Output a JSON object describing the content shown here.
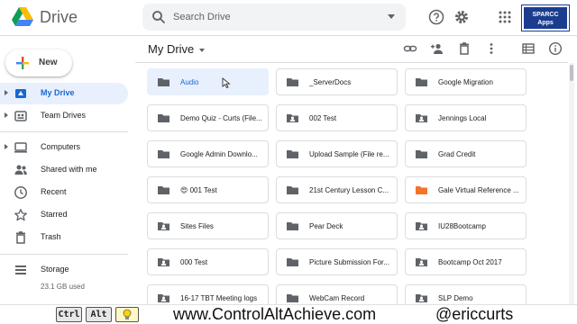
{
  "app": {
    "title": "Drive"
  },
  "search": {
    "placeholder": "Search Drive"
  },
  "org_badge": {
    "line1": "SPARCC",
    "line2": "Apps"
  },
  "sidebar": {
    "new_label": "New",
    "items": [
      {
        "label": "My Drive",
        "icon": "my-drive-icon",
        "active": true,
        "expandable": true
      },
      {
        "label": "Team Drives",
        "icon": "team-drives-icon",
        "active": false,
        "expandable": true
      },
      {
        "label": "Computers",
        "icon": "computers-icon",
        "active": false,
        "expandable": true
      },
      {
        "label": "Shared with me",
        "icon": "shared-icon",
        "active": false,
        "expandable": false
      },
      {
        "label": "Recent",
        "icon": "clock-icon",
        "active": false,
        "expandable": false
      },
      {
        "label": "Starred",
        "icon": "star-icon",
        "active": false,
        "expandable": false
      },
      {
        "label": "Trash",
        "icon": "trash-icon",
        "active": false,
        "expandable": false
      },
      {
        "label": "Storage",
        "icon": "storage-icon",
        "active": false,
        "expandable": false
      }
    ],
    "storage_used": "23.1 GB used"
  },
  "main": {
    "breadcrumb": "My Drive",
    "folders": [
      {
        "name": "Audio",
        "shared": false,
        "color": "#5f6368",
        "selected": true
      },
      {
        "name": "_ServerDocs",
        "shared": false,
        "color": "#5f6368"
      },
      {
        "name": "Google Migration",
        "shared": false,
        "color": "#5f6368"
      },
      {
        "name": "Demo Quiz - Curts (File...",
        "shared": false,
        "color": "#5f6368"
      },
      {
        "name": "002 Test",
        "shared": true,
        "color": "#5f6368"
      },
      {
        "name": "Jennings Local",
        "shared": true,
        "color": "#5f6368"
      },
      {
        "name": "Google Admin Downlo...",
        "shared": false,
        "color": "#5f6368"
      },
      {
        "name": "Upload Sample (File re...",
        "shared": false,
        "color": "#5f6368"
      },
      {
        "name": "Grad Credit",
        "shared": false,
        "color": "#5f6368"
      },
      {
        "name": "😍 001 Test",
        "shared": false,
        "color": "#5f6368"
      },
      {
        "name": "21st Century Lesson C...",
        "shared": false,
        "color": "#5f6368"
      },
      {
        "name": "Gale Virtual Reference ...",
        "shared": false,
        "color": "#f4732a"
      },
      {
        "name": "Sites Files",
        "shared": true,
        "color": "#5f6368"
      },
      {
        "name": "Pear Deck",
        "shared": false,
        "color": "#5f6368"
      },
      {
        "name": "IU28Bootcamp",
        "shared": true,
        "color": "#5f6368"
      },
      {
        "name": "000 Test",
        "shared": true,
        "color": "#5f6368"
      },
      {
        "name": "Picture Submission For...",
        "shared": false,
        "color": "#5f6368"
      },
      {
        "name": "Bootcamp Oct 2017",
        "shared": true,
        "color": "#5f6368"
      },
      {
        "name": "16-17 TBT Meeting logs",
        "shared": true,
        "color": "#5f6368"
      },
      {
        "name": "WebCam Record",
        "shared": false,
        "color": "#5f6368"
      },
      {
        "name": "SLP Demo",
        "shared": true,
        "color": "#5f6368"
      }
    ]
  },
  "footer": {
    "key_ctrl": "Ctrl",
    "key_alt": "Alt",
    "site": "www.ControlAltAchieve.com",
    "handle": "@ericcurts"
  },
  "colors": {
    "accent": "#1967d2",
    "selected_bg": "#e8f0fe",
    "icon_gray": "#5f6368",
    "orange_folder": "#f4732a",
    "badge_blue": "#1a3d8f"
  }
}
